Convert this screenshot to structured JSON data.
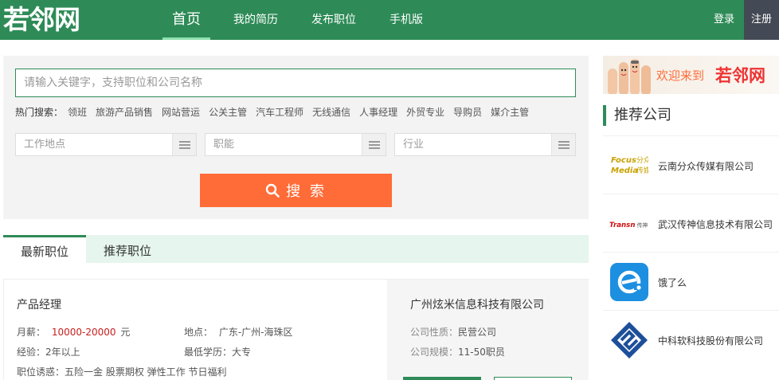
{
  "header": {
    "logo": "若邻网",
    "nav": [
      "首页",
      "我的简历",
      "发布职位",
      "手机版"
    ],
    "login": "登录",
    "register": "注册"
  },
  "search": {
    "placeholder": "请输入关键字，支持职位和公司名称",
    "hot_label": "热门搜索：",
    "hot_terms": [
      "领班",
      "旅游产品销售",
      "网站营运",
      "公关主管",
      "汽车工程师",
      "无线通信",
      "人事经理",
      "外贸专业",
      "导购员",
      "媒介主管"
    ],
    "location": "工作地点",
    "function": "职能",
    "industry": "行业",
    "button": "搜 索"
  },
  "tabs": [
    "最新职位",
    "推荐职位"
  ],
  "job": {
    "title": "产品经理",
    "salary_label": "月薪：",
    "salary_value": "10000-20000",
    "salary_unit": "元",
    "location_label": "地点：",
    "location_value": "广东-广州-海珠区",
    "experience": "经验：2年以上",
    "education": "最低学历：大专",
    "benefits": "职位诱惑：五险一金 股票期权 弹性工作 节日福利",
    "company": {
      "name": "广州炫米信息科技有限公司",
      "nature_label": "公司性质：",
      "nature_value": "民营公司",
      "size_label": "公司规模：",
      "size_value": "11-50职员"
    }
  },
  "sidebar": {
    "banner_text": "欢迎来到",
    "banner_brand": "若邻网",
    "title": "推荐公司",
    "companies": [
      {
        "name": "云南分众传媒有限公司",
        "logo_text": "Focus Media 分众传媒"
      },
      {
        "name": "武汉传神信息技术有限公司",
        "logo_text": "Transn 传神"
      },
      {
        "name": "饿了么",
        "logo_text": "e"
      },
      {
        "name": "中科软科技股份有限公司",
        "logo_text": ""
      }
    ]
  },
  "colors": {
    "brand_green": "#2e8b57",
    "search_orange": "#ff6c37",
    "salary_red": "#c81e1e"
  }
}
